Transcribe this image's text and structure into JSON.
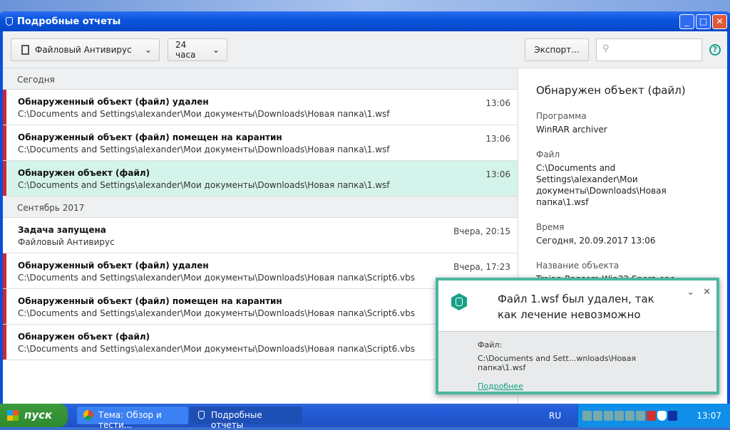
{
  "window": {
    "title": "Подробные отчеты",
    "min": "_",
    "max": "□",
    "close": "✕"
  },
  "toolbar": {
    "component": "Файловый Антивирус",
    "period": "24 часа",
    "export": "Экспорт...",
    "search_placeholder": "",
    "help": "?"
  },
  "sections": [
    {
      "label": "Сегодня",
      "rows": [
        {
          "title": "Обнаруженный объект (файл) удален",
          "path": "C:\\Documents and Settings\\alexander\\Мои документы\\Downloads\\Новая папка\\1.wsf",
          "time": "13:06",
          "red": true,
          "selected": false
        },
        {
          "title": "Обнаруженный объект (файл) помещен на карантин",
          "path": "C:\\Documents and Settings\\alexander\\Мои документы\\Downloads\\Новая папка\\1.wsf",
          "time": "13:06",
          "red": true,
          "selected": false
        },
        {
          "title": "Обнаружен объект (файл)",
          "path": "C:\\Documents and Settings\\alexander\\Мои документы\\Downloads\\Новая папка\\1.wsf",
          "time": "13:06",
          "red": true,
          "selected": true
        }
      ]
    },
    {
      "label": "Сентябрь 2017",
      "rows": [
        {
          "title": "Задача запущена",
          "path": "Файловый Антивирус",
          "time": "Вчера, 20:15",
          "red": false,
          "selected": false
        },
        {
          "title": "Обнаруженный объект (файл) удален",
          "path": "C:\\Documents and Settings\\alexander\\Мои документы\\Downloads\\Новая папка\\Script6.vbs",
          "time": "Вчера, 17:23",
          "red": true,
          "selected": false
        },
        {
          "title": "Обнаруженный объект (файл) помещен на карантин",
          "path": "C:\\Documents and Settings\\alexander\\Мои документы\\Downloads\\Новая папка\\Script6.vbs",
          "time": "",
          "red": true,
          "selected": false
        },
        {
          "title": "Обнаружен объект (файл)",
          "path": "C:\\Documents and Settings\\alexander\\Мои документы\\Downloads\\Новая папка\\Script6.vbs",
          "time": "",
          "red": true,
          "selected": false
        }
      ]
    }
  ],
  "detail": {
    "title": "Обнаружен объект (файл)",
    "fields": [
      {
        "label": "Программа",
        "value": "WinRAR archiver"
      },
      {
        "label": "Файл",
        "value": "C:\\Documents and Settings\\alexander\\Мои документы\\Downloads\\Новая папка\\1.wsf"
      },
      {
        "label": "Время",
        "value": "Сегодня, 20.09.2017 13:06"
      },
      {
        "label": "Название объекта",
        "value": "Trojan-Ransom.Win32.Spora.epc"
      }
    ]
  },
  "popup": {
    "message": "Файл 1.wsf был удален, так как лечение невозможно",
    "file_label": "Файл:",
    "file_path": "C:\\Documents and Sett...wnloads\\Новая папка\\1.wsf",
    "link": "Подробнее",
    "collapse": "⌄",
    "close": "✕"
  },
  "taskbar": {
    "start": "пуск",
    "items": [
      "Тема: Обзор и тести...",
      "Подробные отчеты"
    ],
    "lang": "RU",
    "clock": "13:07"
  }
}
